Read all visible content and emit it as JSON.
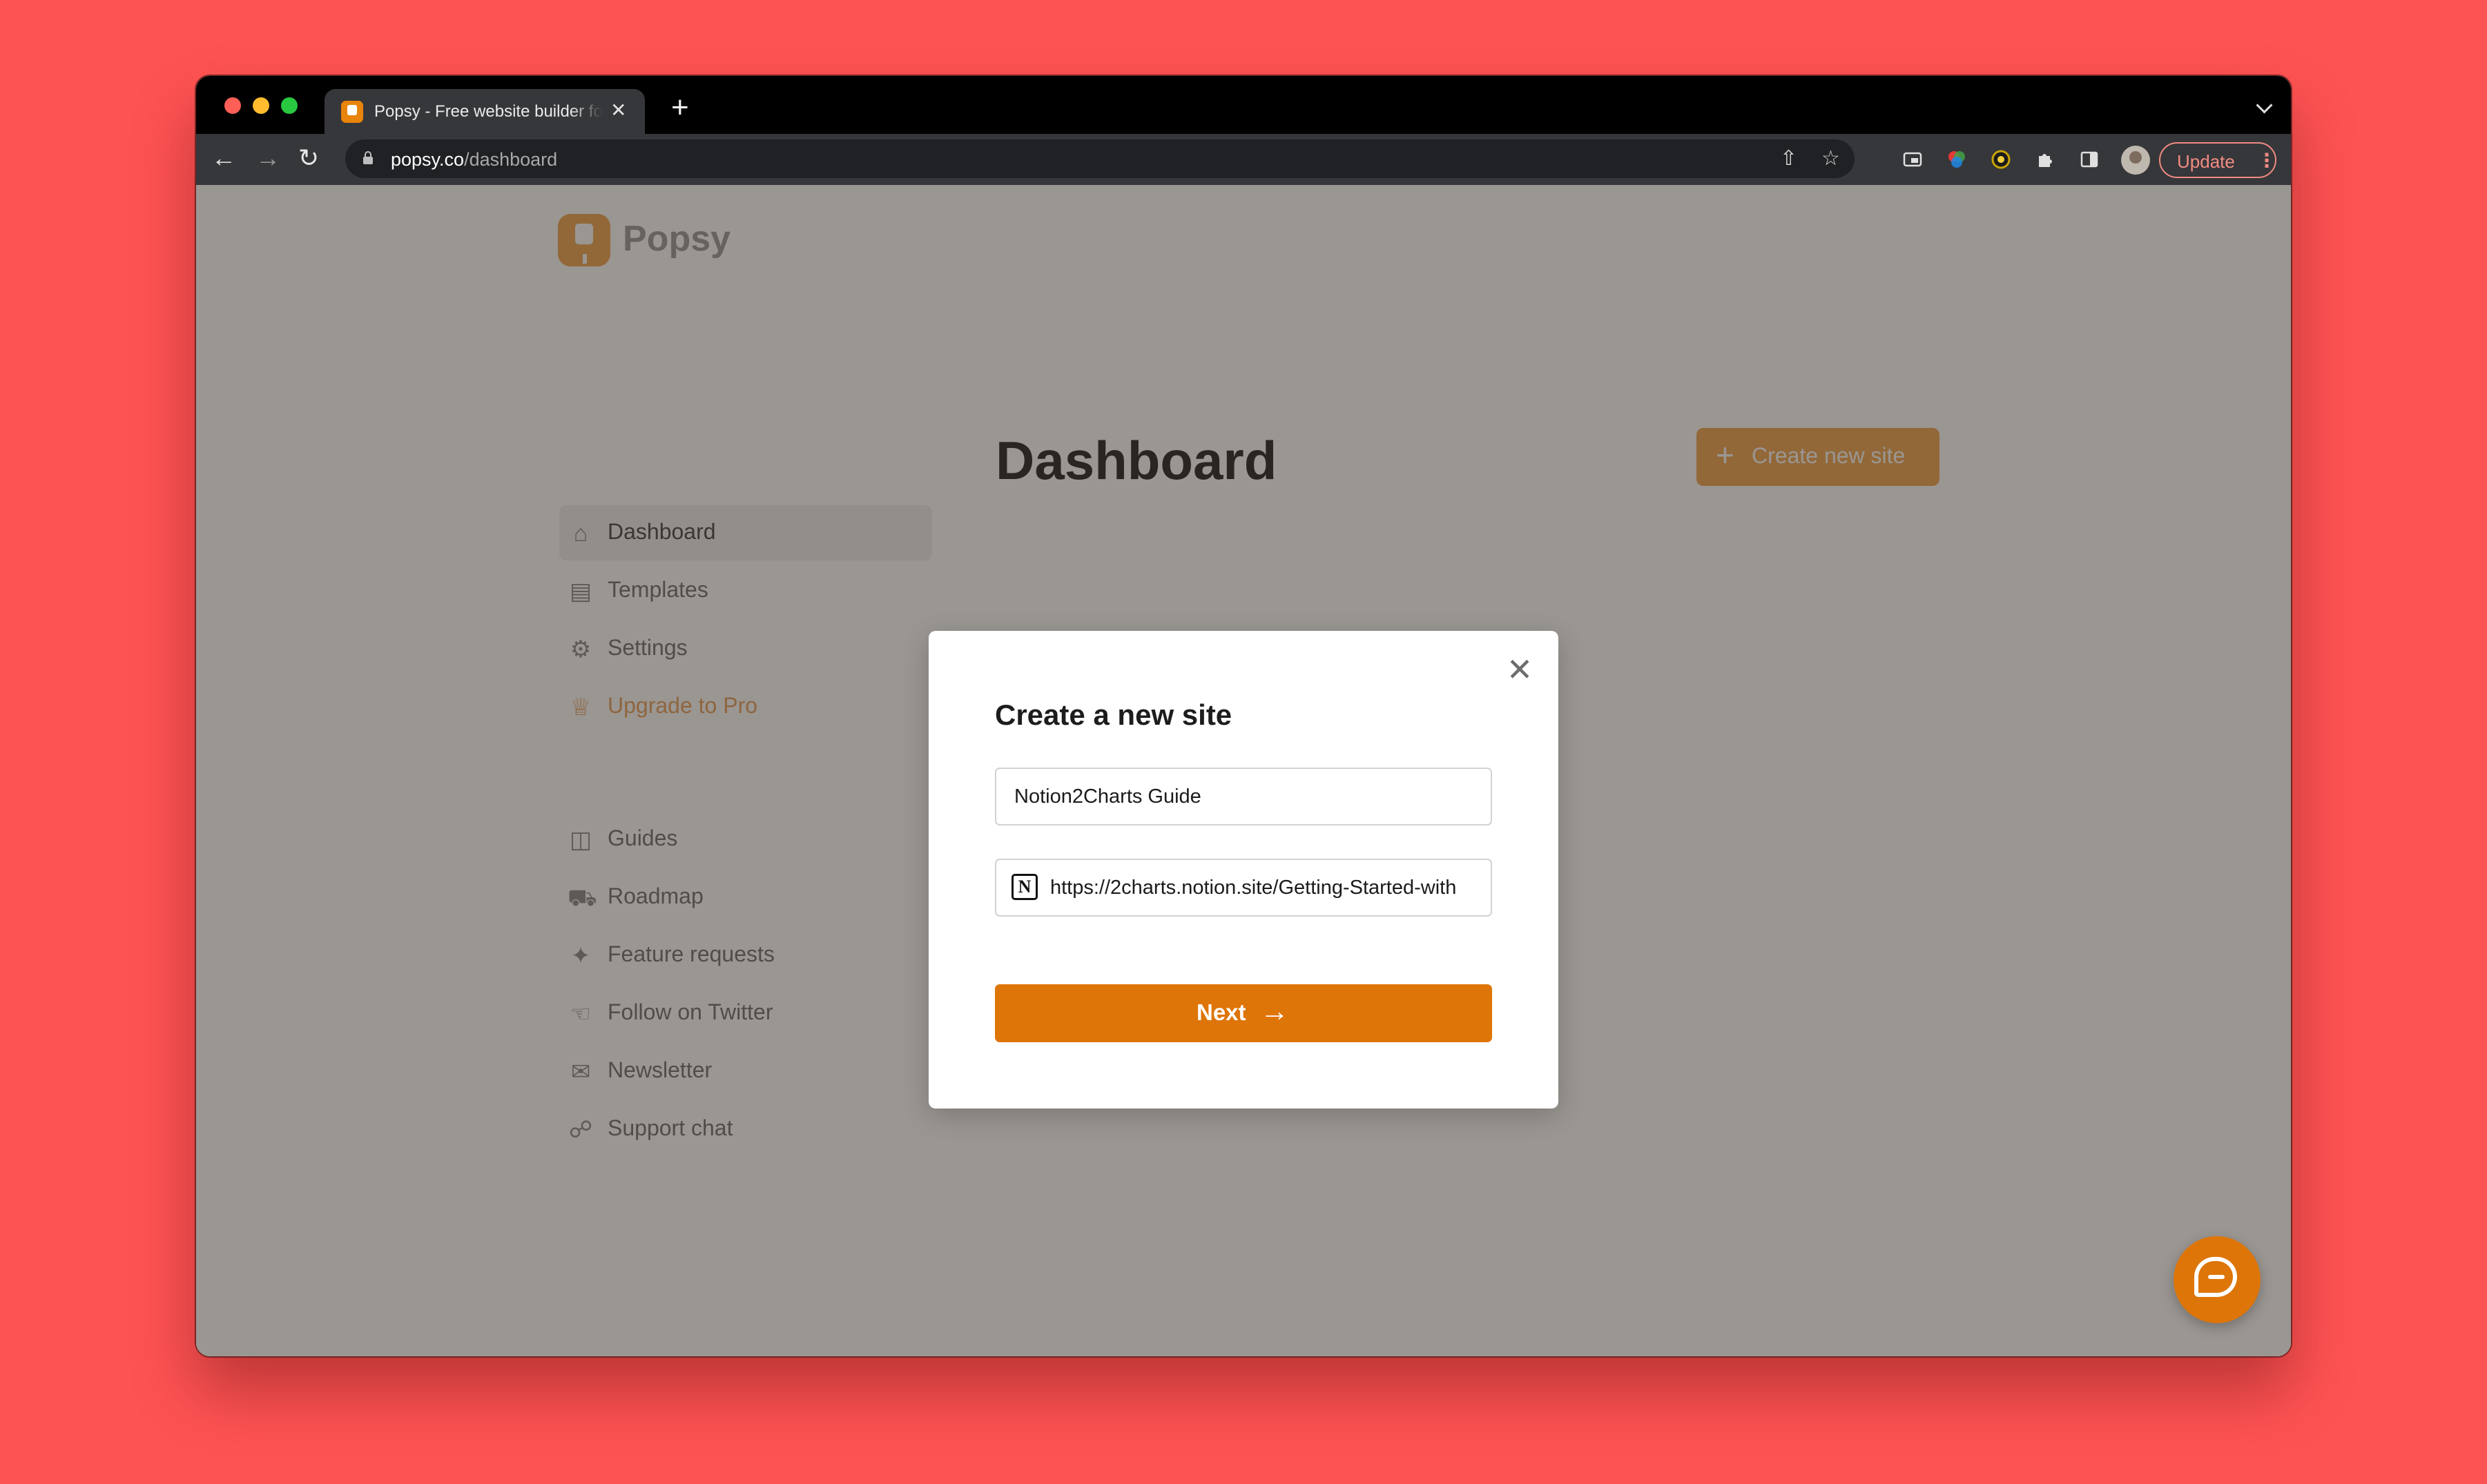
{
  "browser": {
    "tab_title": "Popsy - Free website builder for Notion",
    "tab_close": "✕",
    "new_tab": "+",
    "url_host": "popsy.co",
    "url_path": "/dashboard",
    "update_label": "Update",
    "menu_dots": "⋮"
  },
  "app": {
    "brand": "Popsy",
    "accent_color": "#de7508",
    "sidebar": {
      "primary": [
        {
          "label": "Dashboard",
          "icon": "home-icon"
        },
        {
          "label": "Templates",
          "icon": "templates-icon"
        },
        {
          "label": "Settings",
          "icon": "gear-icon"
        },
        {
          "label": "Upgrade to Pro",
          "icon": "crown-icon"
        }
      ],
      "secondary": [
        {
          "label": "Guides",
          "icon": "book-icon"
        },
        {
          "label": "Roadmap",
          "icon": "truck-icon"
        },
        {
          "label": "Feature requests",
          "icon": "sparkle-icon"
        },
        {
          "label": "Follow on Twitter",
          "icon": "twitter-icon"
        },
        {
          "label": "Newsletter",
          "icon": "mail-icon"
        },
        {
          "label": "Support chat",
          "icon": "chat-icon"
        }
      ]
    },
    "page_title": "Dashboard",
    "create_button": "Create new site"
  },
  "modal": {
    "title": "Create a new site",
    "close": "✕",
    "site_name_value": "Notion2Charts Guide",
    "notion_url_value": "https://2charts.notion.site/Getting-Started-with",
    "notion_icon": "N",
    "next_label": "Next",
    "next_arrow": "→"
  }
}
